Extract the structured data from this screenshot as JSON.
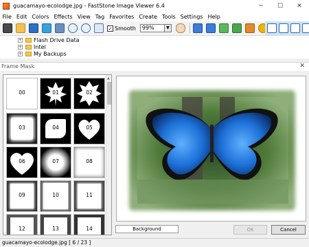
{
  "window": {
    "title": "guacamayo-ecolodge.jpg - FastStone Image Viewer 6.4"
  },
  "menu": [
    "File",
    "Edit",
    "Colors",
    "Effects",
    "View",
    "Tag",
    "Favorites",
    "Create",
    "Tools",
    "Settings",
    "Help"
  ],
  "toolbar": {
    "smooth_label": "Smooth",
    "smooth_checked": "✓",
    "zoom_value": "99%"
  },
  "tree": {
    "items": [
      "Flash Drive Data",
      "Intel",
      "My Backups"
    ],
    "expander": "+"
  },
  "dialog": {
    "title": "Frame Mask",
    "thumbnails": [
      "00",
      "01",
      "02",
      "03",
      "04",
      "05",
      "06",
      "07",
      "08",
      "09",
      "10",
      "11",
      "12",
      "13",
      "14"
    ],
    "background_label": "Background",
    "ok_label": "OK",
    "cancel_label": "Cancel"
  },
  "status": {
    "text": "guacamayo-ecolodge.jpg [ 6 / 23 ]"
  }
}
